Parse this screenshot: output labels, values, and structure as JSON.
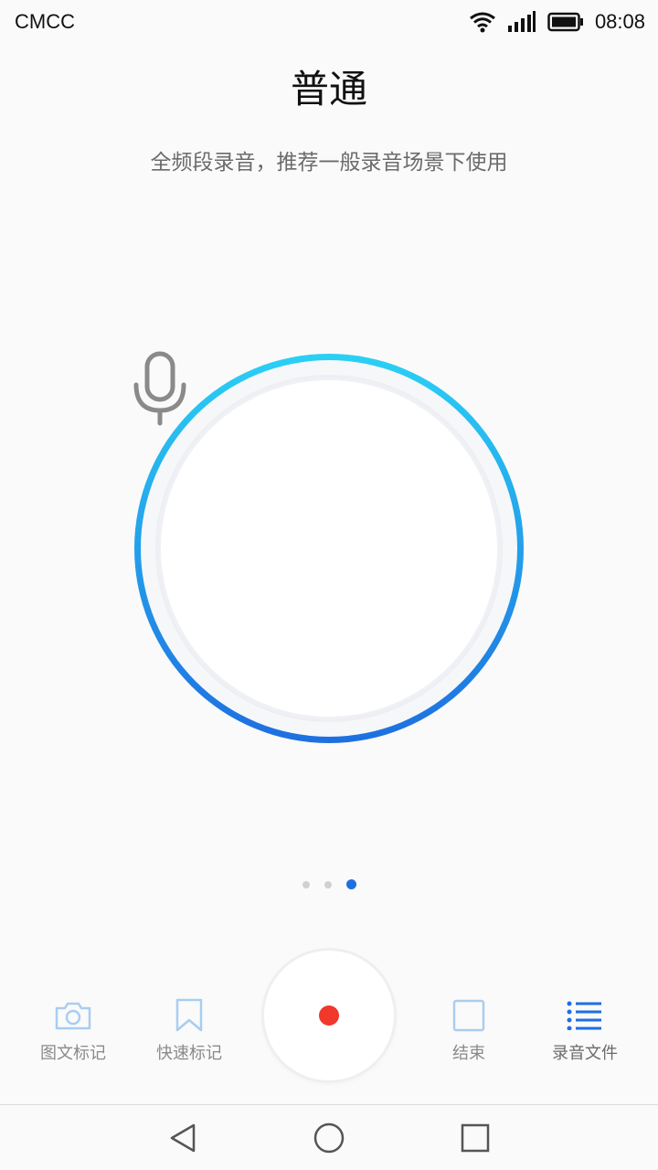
{
  "status_bar": {
    "carrier": "CMCC",
    "time": "08:08",
    "icons": [
      "wifi-icon",
      "signal-icon",
      "battery-icon"
    ]
  },
  "mode": {
    "title": "普通",
    "description": "全频段录音，推荐一般录音场景下使用"
  },
  "recorder": {
    "center_icon": "microphone-icon",
    "ring_colors": [
      "#2ad0f4",
      "#1e6fe0"
    ]
  },
  "pager": {
    "count": 3,
    "active_index": 2
  },
  "toolbar": {
    "photo_mark_label": "图文标记",
    "quick_mark_label": "快速标记",
    "stop_label": "结束",
    "files_label": "录音文件",
    "record_color": "#f0382b",
    "accent": "#1e6fe0"
  },
  "nav": {
    "icons": [
      "back-icon",
      "home-icon",
      "recents-icon"
    ]
  }
}
